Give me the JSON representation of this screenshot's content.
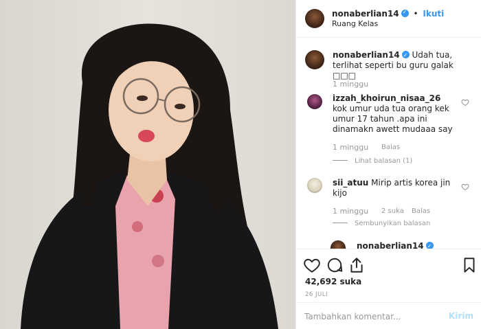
{
  "post": {
    "author": "nonaberlian14",
    "follow_label": "Ikuti",
    "dot": "•",
    "location": "Ruang Kelas"
  },
  "caption": {
    "username": "nonaberlian14",
    "text": "Udah tua, terlihat seperti bu guru galak □□□",
    "time": "1 minggu"
  },
  "comments": [
    {
      "username": "izzah_khoirun_nisaa_26",
      "text": "kok umur uda tua orang kek umur 17 tahun .apa ini dinamakn awett mudaaa say",
      "time": "1 minggu",
      "reply_label": "Balas",
      "replies_toggle": "Lihat balasan (1)"
    },
    {
      "username": "sii_atuu",
      "text": "Mirip artis korea jin kijo",
      "time": "1 minggu",
      "likes": "2 suka",
      "reply_label": "Balas",
      "replies_toggle": "Sembunyikan balasan"
    },
    {
      "username": "nonaberlian14"
    }
  ],
  "stats": {
    "likes": "42,692 suka",
    "date": "26 JULI"
  },
  "compose": {
    "placeholder": "Tambahkan komentar...",
    "post_label": "Kirim"
  },
  "icons": [
    "heart-icon",
    "comment-icon",
    "share-icon",
    "bookmark-icon",
    "verified-badge-icon"
  ],
  "colors": {
    "accent": "#3897f0",
    "muted": "#999999",
    "post_disabled": "#b2dffc"
  }
}
